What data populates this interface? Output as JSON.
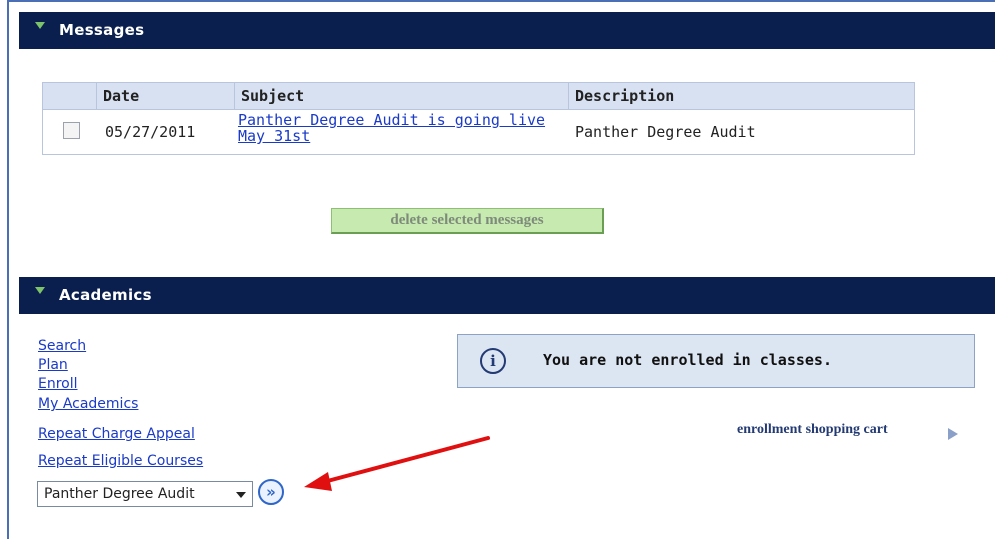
{
  "messages": {
    "title": "Messages",
    "table": {
      "headers": {
        "date": "Date",
        "subject": "Subject",
        "description": "Description"
      },
      "rows": [
        {
          "date": "05/27/2011",
          "subject": "Panther Degree Audit is going live May 31st",
          "description": "Panther Degree Audit"
        }
      ]
    },
    "delete_button": "delete selected messages"
  },
  "academics": {
    "title": "Academics",
    "links": [
      "Search",
      "Plan",
      "Enroll",
      "My Academics",
      "Repeat Charge Appeal",
      "Repeat Eligible Courses"
    ],
    "select": {
      "value": "Panther Degree Audit"
    },
    "go_symbol": "»",
    "info": {
      "icon": "info-icon",
      "glyph": "i",
      "text": "You are not enrolled in classes."
    },
    "cart_link": "enrollment shopping cart"
  },
  "colors": {
    "header_bg": "#0a1f4e",
    "triangle": "#7cc36a",
    "link": "#1a3ac8",
    "annotation_arrow": "#e01010"
  }
}
